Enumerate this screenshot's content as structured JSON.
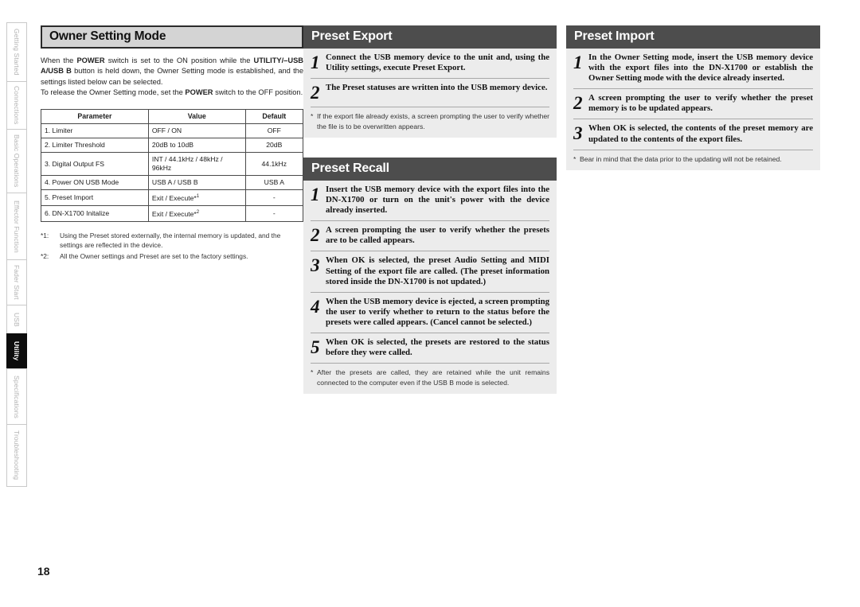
{
  "sidebar": {
    "items": [
      {
        "label": "Getting Started",
        "active": false,
        "height": 74
      },
      {
        "label": "Connections",
        "active": false,
        "height": 60
      },
      {
        "label": "Basic Operations",
        "active": false,
        "height": 80
      },
      {
        "label": "Effector Function",
        "active": false,
        "height": 84
      },
      {
        "label": "Fader Start",
        "active": false,
        "height": 57
      },
      {
        "label": "USB",
        "active": false,
        "height": 36
      },
      {
        "label": "Utility",
        "active": true,
        "height": 44
      },
      {
        "label": "Specifications",
        "active": false,
        "height": 70
      },
      {
        "label": "Troubleshooting",
        "active": false,
        "height": 79
      }
    ]
  },
  "left_column": {
    "heading": "Owner Setting Mode",
    "paragraph_1_pre": "When the ",
    "paragraph_1_b1": "POWER",
    "paragraph_1_mid1": " switch is set to the ON position while the ",
    "paragraph_1_b2": "UTILITY/–USB A/USB B",
    "paragraph_1_mid2": " button is held down, the Owner Setting mode is established, and the settings listed below can be selected.",
    "paragraph_2_pre": "To release the Owner Setting mode, set the ",
    "paragraph_2_b1": "POWER",
    "paragraph_2_post": " switch to the OFF position.",
    "table": {
      "headers": [
        "Parameter",
        "Value",
        "Default"
      ],
      "rows": [
        {
          "parameter": "1. Limiter",
          "value": "OFF / ON",
          "value_sup": "",
          "default": "OFF"
        },
        {
          "parameter": "2. Limiter Threshold",
          "value": "20dB to 10dB",
          "value_sup": "",
          "default": "20dB"
        },
        {
          "parameter": "3. Digital Output FS",
          "value": "INT / 44.1kHz / 48kHz / 96kHz",
          "value_sup": "",
          "default": "44.1kHz"
        },
        {
          "parameter": "4. Power ON USB Mode",
          "value": "USB A / USB B",
          "value_sup": "",
          "default": "USB A"
        },
        {
          "parameter": "5. Preset Import",
          "value": "Exit / Execute*",
          "value_sup": "1",
          "default": "-"
        },
        {
          "parameter": "6. DN-X1700 Initalize",
          "value": "Exit / Execute*",
          "value_sup": "2",
          "default": "-"
        }
      ]
    },
    "footnotes": [
      {
        "mark": "*1:",
        "text": "Using the Preset stored externally, the internal memory is updated, and the settings are reflected in the device."
      },
      {
        "mark": "*2:",
        "text": "All the Owner settings and Preset are set to the factory settings."
      }
    ]
  },
  "preset_export": {
    "title": "Preset Export",
    "steps": [
      {
        "num": "1",
        "text": "Connect the USB memory device to the unit and, using the Utility settings, execute Preset Export."
      },
      {
        "num": "2",
        "text": "The Preset statuses are written into the USB memory device."
      }
    ],
    "note_star": "*",
    "note": "If the export file already exists, a screen prompting the user to verify whether the file is to be overwritten appears."
  },
  "preset_recall": {
    "title": "Preset Recall",
    "steps": [
      {
        "num": "1",
        "text": "Insert the USB memory device with the export files into the DN-X1700 or turn on the unit's power with the device already inserted."
      },
      {
        "num": "2",
        "text": "A screen prompting the user to verify whether the presets are to be called appears."
      },
      {
        "num": "3",
        "text": "When OK is selected, the preset Audio Setting and MIDI Setting of the export file are called. (The preset information stored inside the DN-X1700 is not updated.)"
      },
      {
        "num": "4",
        "text": "When the USB memory device is ejected, a screen prompting the user to verify whether to return to the status before the presets were called appears. (Cancel cannot be selected.)"
      },
      {
        "num": "5",
        "text": "When OK is selected, the presets are restored to the status before they were called."
      }
    ],
    "note_star": "*",
    "note": "After the presets are called, they are retained while the unit remains connected to the computer even if the USB B mode is selected."
  },
  "preset_import": {
    "title": "Preset Import",
    "steps": [
      {
        "num": "1",
        "text": "In the Owner Setting mode, insert the USB memory device with the export files into the DN-X1700 or establish the Owner Setting mode with the device already inserted."
      },
      {
        "num": "2",
        "text": "A screen prompting the user to verify whether the preset memory is to be updated appears."
      },
      {
        "num": "3",
        "text": "When OK is selected, the contents of the preset memory are updated to the contents of the export files."
      }
    ],
    "note_star": "*",
    "note": "Bear in mind that the data prior to the updating will not be retained."
  },
  "page_number": "18",
  "colors": {
    "panel_header_bg": "#4d4d4d",
    "panel_bg": "#ececec",
    "heading_box_bg": "#d4d4d4",
    "active_tab_bg": "#0d0d0d"
  }
}
